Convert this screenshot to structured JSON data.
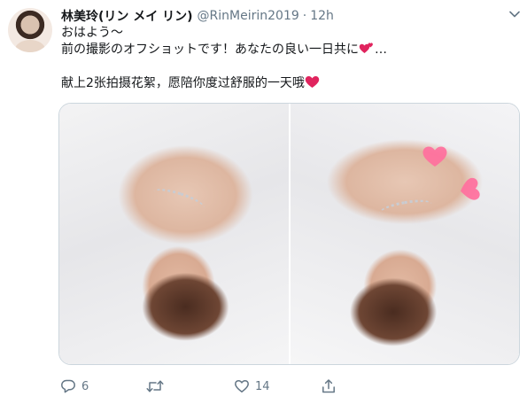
{
  "author": {
    "display_name": "林美玲(リン メイ リン)",
    "handle": "@RinMeirin2019",
    "separator": "·",
    "time": "12h"
  },
  "tweet": {
    "lines": [
      "おはよう〜",
      "前の撮影のオフショットです！あなたの良い一日共に",
      "献上2张拍摄花絮，愿陪你度过舒服的一天哦"
    ],
    "line2_suffix": "…"
  },
  "media": {
    "icon": "two-photo-gallery"
  },
  "actions": {
    "reply_count": "6",
    "retweet_count": "",
    "like_count": "14",
    "share_count": ""
  },
  "colors": {
    "accent": "#1da1f2",
    "muted": "#657786",
    "heart": "#e0245e",
    "sticker_pink": "#ff6f9d"
  }
}
